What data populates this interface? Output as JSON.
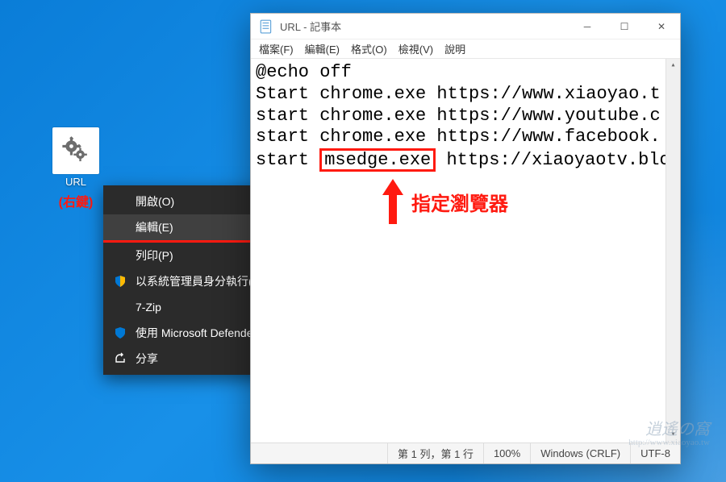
{
  "desktop": {
    "icon_label": "URL",
    "right_click_hint": "(右鍵)"
  },
  "context_menu": {
    "items": [
      {
        "label": "開啟(O)",
        "icon": null
      },
      {
        "label": "編輯(E)",
        "icon": null,
        "highlighted": true
      },
      {
        "label": "列印(P)",
        "icon": null
      },
      {
        "label": "以系統管理員身分執行(A)",
        "icon": "shield"
      },
      {
        "label": "7-Zip",
        "icon": null,
        "submenu": true
      },
      {
        "label": "使用 Microsoft Defender 掃描...",
        "icon": "defender"
      },
      {
        "label": "分享",
        "icon": "share"
      }
    ]
  },
  "notepad": {
    "title": "URL - 記事本",
    "menus": [
      "檔案(F)",
      "編輯(E)",
      "格式(O)",
      "檢視(V)",
      "說明"
    ],
    "lines": [
      {
        "text": "@echo off"
      },
      {
        "text": "Start chrome.exe https://www.xiaoyao.t"
      },
      {
        "text": "start chrome.exe https://www.youtube.c"
      },
      {
        "text": "start chrome.exe https://www.facebook."
      },
      {
        "prefix": "start ",
        "boxed": "msedge.exe",
        "suffix": " https://xiaoyaotv.blo"
      }
    ],
    "status": {
      "position": "第 1 列，第 1 行",
      "zoom": "100%",
      "eol": "Windows (CRLF)",
      "encoding": "UTF-8"
    }
  },
  "annotation": {
    "specify_browser": "指定瀏覽器"
  },
  "watermark": {
    "line1": "逍遙の窩",
    "line2": "http://www.xiaoyao.tw"
  }
}
